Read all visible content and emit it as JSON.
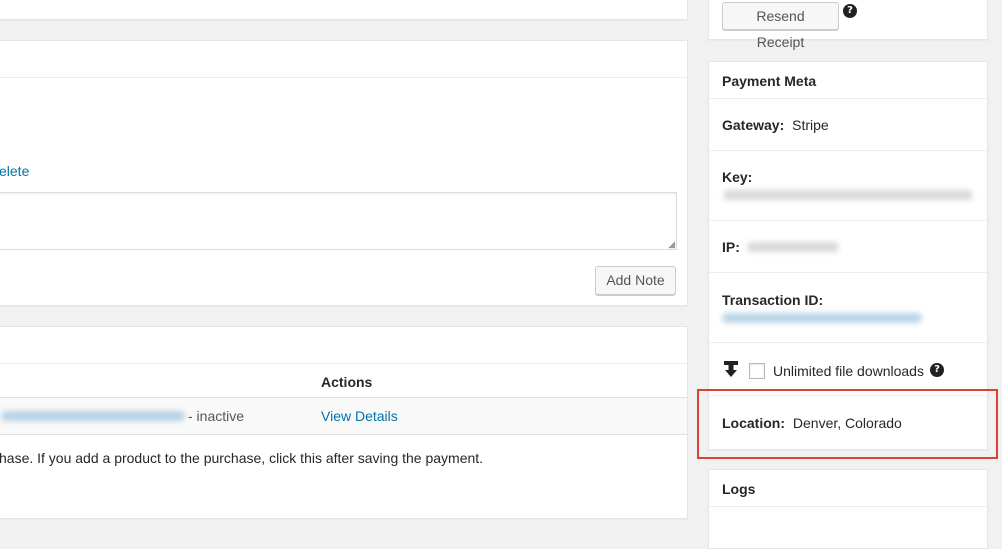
{
  "notes": {
    "delete_link": "elete",
    "add_note_label": "Add Note"
  },
  "licenses": {
    "actions_header": "Actions",
    "row_status": "- inactive",
    "view_details_label": "View Details",
    "help_text": "hase. If you add a product to the purchase, click this after saving the payment."
  },
  "receipt": {
    "resend_label": "Resend Receipt"
  },
  "payment_meta": {
    "title": "Payment Meta",
    "gateway_label": "Gateway:",
    "gateway_value": "Stripe",
    "key_label": "Key:",
    "ip_label": "IP:",
    "transaction_label": "Transaction ID:",
    "unlimited_label": "Unlimited file downloads",
    "unlimited_checked": false,
    "location_label": "Location:",
    "location_value": "Denver, Colorado"
  },
  "logs": {
    "title": "Logs"
  },
  "colors": {
    "link": "#0073aa",
    "highlight_border": "#d94235",
    "icon": "#222222"
  }
}
